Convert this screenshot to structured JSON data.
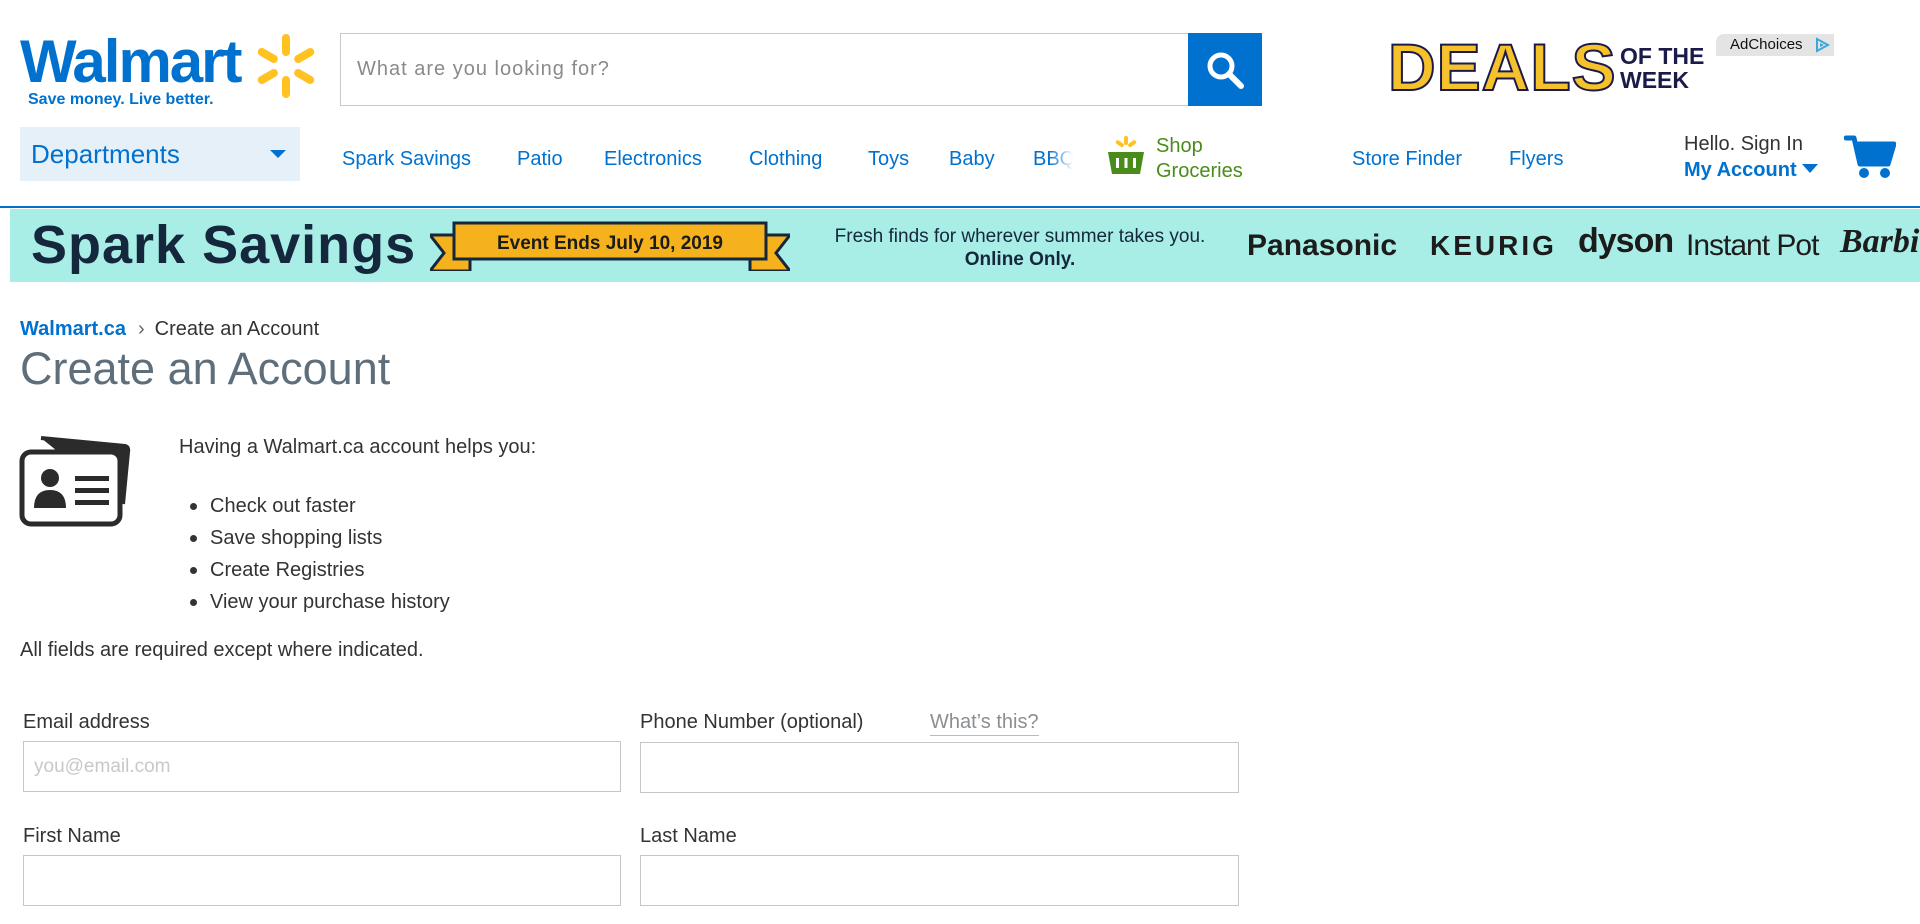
{
  "header": {
    "logo": {
      "word": "Walmart",
      "tagline": "Save money. Live better."
    },
    "search": {
      "placeholder": "What are you looking for?",
      "value": ""
    },
    "ad": {
      "deals": "DEALS",
      "of_the_week": "OF THE WEEK",
      "adchoices": "AdChoices"
    },
    "departments_label": "Departments",
    "nav": [
      {
        "label": "Spark Savings"
      },
      {
        "label": "Patio"
      },
      {
        "label": "Electronics"
      },
      {
        "label": "Clothing"
      },
      {
        "label": "Toys"
      },
      {
        "label": "Baby"
      },
      {
        "label": "BBQ"
      }
    ],
    "groceries_label": "Shop Groceries",
    "store_finder": "Store Finder",
    "flyers": "Flyers",
    "account": {
      "greeting": "Hello. Sign In",
      "label": "My Account"
    }
  },
  "banner": {
    "title": "Spark Savings",
    "event": "Event Ends July 10, 2019",
    "tagline": "Fresh finds for wherever summer takes you.",
    "tagline_bold": "Online Only.",
    "brands": [
      "Panasonic",
      "KEURIG",
      "dyson",
      "Instant Pot",
      "Barbie"
    ]
  },
  "breadcrumb": {
    "home": "Walmart.ca",
    "separator": "›",
    "current": "Create an Account"
  },
  "page_title": "Create an Account",
  "intro": "Having a Walmart.ca account helps you:",
  "benefits": [
    "Check out faster",
    "Save shopping lists",
    "Create Registries",
    "View your purchase history"
  ],
  "required_note": "All fields are required except where indicated.",
  "form": {
    "email": {
      "label": "Email address",
      "placeholder": "you@email.com",
      "value": ""
    },
    "phone": {
      "label": "Phone Number (optional)",
      "help": "What’s this?",
      "value": ""
    },
    "first_name": {
      "label": "First Name",
      "value": ""
    },
    "last_name": {
      "label": "Last Name",
      "value": ""
    }
  },
  "colors": {
    "brand_blue": "#0071ce",
    "spark_yellow": "#ffc220",
    "banner_bg": "#a8eee6",
    "grocery_green": "#4a8c1c",
    "title_gray": "#5e6e7b"
  },
  "icons": [
    "spark-logo-icon",
    "search-icon",
    "adchoices-icon",
    "chevron-down-icon",
    "grocery-basket-icon",
    "cart-icon",
    "id-card-icon"
  ]
}
